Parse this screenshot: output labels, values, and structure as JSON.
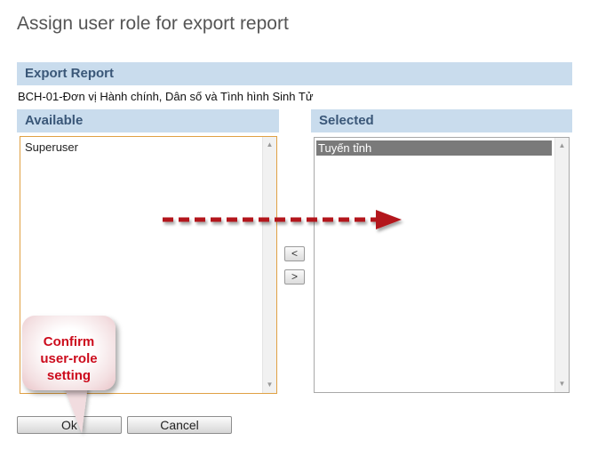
{
  "page": {
    "title": "Assign user role for export report"
  },
  "report_section": {
    "header": "Export Report",
    "report_name": "BCH-01-Đơn vị Hành chính, Dân số và Tình hình Sinh Tử"
  },
  "available": {
    "header": "Available",
    "items": [
      "Superuser"
    ]
  },
  "selected": {
    "header": "Selected",
    "items": [
      "Tuyến tỉnh"
    ]
  },
  "move_buttons": {
    "left_label": "<",
    "right_label": ">"
  },
  "actions": {
    "ok_label": "Ok",
    "cancel_label": "Cancel"
  },
  "annotation": {
    "callout_lines": [
      "Confirm",
      "user-role",
      "setting"
    ],
    "arrow_color": "#b3161c",
    "text_color": "#cc0b1c"
  },
  "icons": {
    "scroll_up": "scroll-up-icon",
    "scroll_down": "scroll-down-icon"
  }
}
